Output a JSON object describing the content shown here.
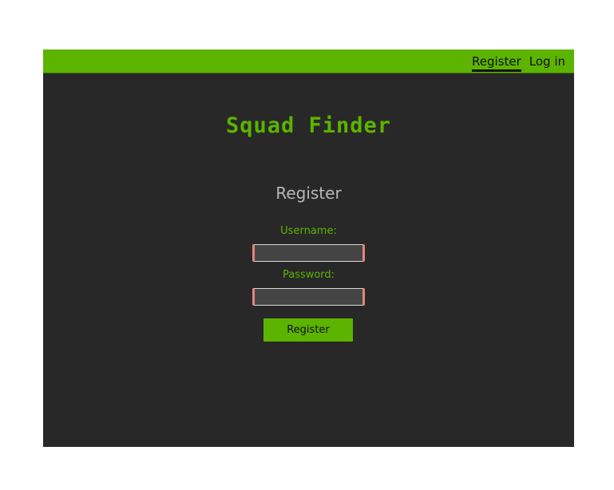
{
  "nav": {
    "register_label": "Register",
    "login_label": "Log in"
  },
  "brand": {
    "title": "Squad Finder"
  },
  "form": {
    "title": "Register",
    "username_label": "Username:",
    "username_value": "",
    "password_label": "Password:",
    "password_value": "",
    "submit_label": "Register"
  },
  "colors": {
    "accent": "#5cb300",
    "background": "#282828",
    "input_border_error": "#e8827a"
  }
}
